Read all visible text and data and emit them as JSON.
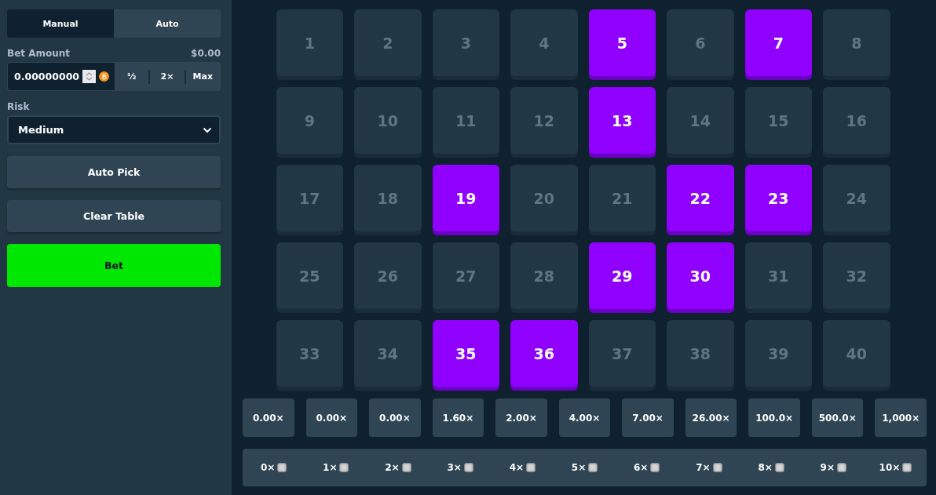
{
  "mode_tabs": [
    {
      "label": "Manual",
      "selected": true
    },
    {
      "label": "Auto",
      "selected": false
    }
  ],
  "bet_amount": {
    "label": "Bet Amount",
    "usd": "$0.00",
    "value": "0.00000000",
    "buttons": [
      "½",
      "2×",
      "Max"
    ]
  },
  "risk": {
    "label": "Risk",
    "value": "Medium"
  },
  "actions": [
    "Auto Pick",
    "Clear Table"
  ],
  "bet_button": "Bet",
  "tiles": [
    {
      "label": "1",
      "selected": false
    },
    {
      "label": "2",
      "selected": false
    },
    {
      "label": "3",
      "selected": false
    },
    {
      "label": "4",
      "selected": false
    },
    {
      "label": "5",
      "selected": true
    },
    {
      "label": "6",
      "selected": false
    },
    {
      "label": "7",
      "selected": true
    },
    {
      "label": "8",
      "selected": false
    },
    {
      "label": "9",
      "selected": false
    },
    {
      "label": "10",
      "selected": false
    },
    {
      "label": "11",
      "selected": false
    },
    {
      "label": "12",
      "selected": false
    },
    {
      "label": "13",
      "selected": true
    },
    {
      "label": "14",
      "selected": false
    },
    {
      "label": "15",
      "selected": false
    },
    {
      "label": "16",
      "selected": false
    },
    {
      "label": "17",
      "selected": false
    },
    {
      "label": "18",
      "selected": false
    },
    {
      "label": "19",
      "selected": true
    },
    {
      "label": "20",
      "selected": false
    },
    {
      "label": "21",
      "selected": false
    },
    {
      "label": "22",
      "selected": true
    },
    {
      "label": "23",
      "selected": true
    },
    {
      "label": "24",
      "selected": false
    },
    {
      "label": "25",
      "selected": false
    },
    {
      "label": "26",
      "selected": false
    },
    {
      "label": "27",
      "selected": false
    },
    {
      "label": "28",
      "selected": false
    },
    {
      "label": "29",
      "selected": true
    },
    {
      "label": "30",
      "selected": true
    },
    {
      "label": "31",
      "selected": false
    },
    {
      "label": "32",
      "selected": false
    },
    {
      "label": "33",
      "selected": false
    },
    {
      "label": "34",
      "selected": false
    },
    {
      "label": "35",
      "selected": true
    },
    {
      "label": "36",
      "selected": true
    },
    {
      "label": "37",
      "selected": false
    },
    {
      "label": "38",
      "selected": false
    },
    {
      "label": "39",
      "selected": false
    },
    {
      "label": "40",
      "selected": false
    }
  ],
  "payouts": [
    "0.00×",
    "0.00×",
    "0.00×",
    "1.60×",
    "2.00×",
    "4.00×",
    "7.00×",
    "26.00×",
    "100.0×",
    "500.0×",
    "1,000×"
  ],
  "hits": [
    "0×",
    "1×",
    "2×",
    "3×",
    "4×",
    "5×",
    "6×",
    "7×",
    "8×",
    "9×",
    "10×"
  ]
}
